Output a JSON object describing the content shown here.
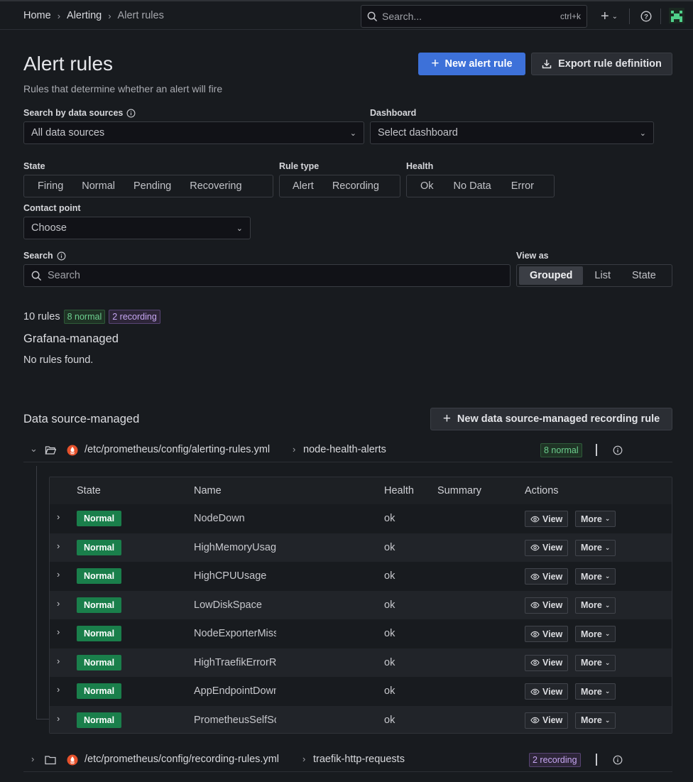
{
  "breadcrumb": [
    "Home",
    "Alerting",
    "Alert rules"
  ],
  "topbar": {
    "search_placeholder": "Search...",
    "search_shortcut": "ctrl+k"
  },
  "page": {
    "title": "Alert rules",
    "subtitle": "Rules that determine whether an alert will fire",
    "new_rule_label": "New alert rule",
    "export_label": "Export rule definition"
  },
  "filters": {
    "datasource_label": "Search by data sources",
    "datasource_value": "All data sources",
    "dashboard_label": "Dashboard",
    "dashboard_placeholder": "Select dashboard",
    "state_label": "State",
    "state_options": [
      "Firing",
      "Normal",
      "Pending",
      "Recovering"
    ],
    "ruletype_label": "Rule type",
    "ruletype_options": [
      "Alert",
      "Recording"
    ],
    "health_label": "Health",
    "health_options": [
      "Ok",
      "No Data",
      "Error"
    ],
    "contact_label": "Contact point",
    "contact_placeholder": "Choose",
    "search_label": "Search",
    "search_placeholder": "Search",
    "viewas_label": "View as",
    "viewas_options": [
      "Grouped",
      "List",
      "State"
    ],
    "viewas_selected": "Grouped"
  },
  "summary": {
    "count": "10 rules",
    "normal": "8 normal",
    "recording": "2 recording"
  },
  "grafana_managed": {
    "title": "Grafana-managed",
    "empty": "No rules found."
  },
  "datasource_managed": {
    "title": "Data source-managed",
    "new_recording_label": "New data source-managed recording rule",
    "namespaces": [
      {
        "path": "/etc/prometheus/config/alerting-rules.yml",
        "group": "node-health-alerts",
        "badge": "8 normal"
      },
      {
        "path": "/etc/prometheus/config/recording-rules.yml",
        "group": "traefik-http-requests",
        "badge": "2 recording"
      }
    ]
  },
  "table": {
    "headers": [
      "State",
      "Name",
      "Health",
      "Summary",
      "Actions"
    ],
    "view_label": "View",
    "more_label": "More",
    "rows": [
      {
        "state": "Normal",
        "name": "NodeDown",
        "health": "ok"
      },
      {
        "state": "Normal",
        "name": "HighMemoryUsage",
        "health": "ok"
      },
      {
        "state": "Normal",
        "name": "HighCPUUsage",
        "health": "ok"
      },
      {
        "state": "Normal",
        "name": "LowDiskSpace",
        "health": "ok"
      },
      {
        "state": "Normal",
        "name": "NodeExporterMissing",
        "health": "ok"
      },
      {
        "state": "Normal",
        "name": "HighTraefikErrorRate",
        "health": "ok"
      },
      {
        "state": "Normal",
        "name": "AppEndpointDown",
        "health": "ok"
      },
      {
        "state": "Normal",
        "name": "PrometheusSelfScrape",
        "health": "ok"
      }
    ]
  },
  "colors": {
    "primary": "#3d71d9",
    "normal": "#1a7f4b",
    "background": "#181b1f"
  }
}
